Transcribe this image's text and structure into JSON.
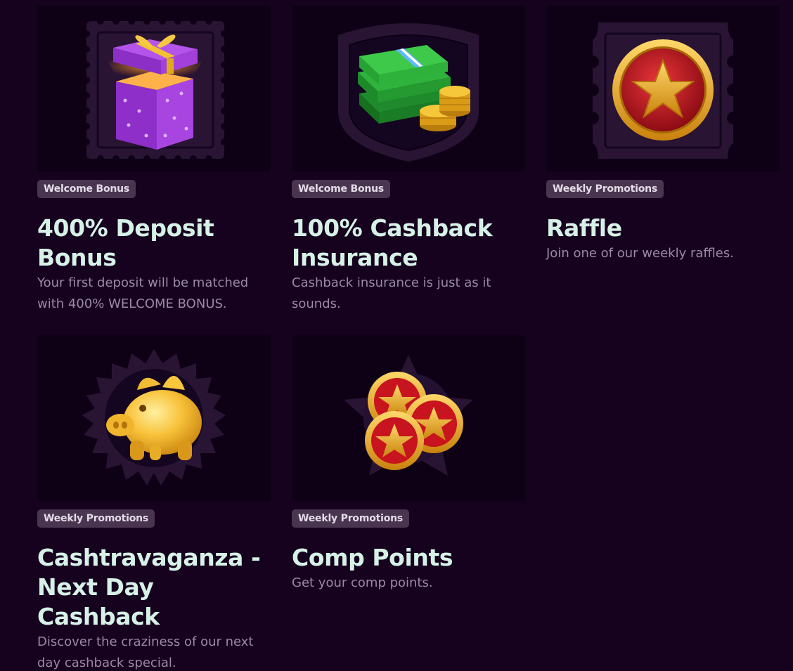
{
  "promotions": [
    {
      "badge": "Welcome Bonus",
      "title": "400% Deposit Bonus",
      "description": "Your first deposit will be matched with 400% WELCOME BONUS.",
      "icon": "gift-box-icon"
    },
    {
      "badge": "Welcome Bonus",
      "title": "100% Cashback Insurance",
      "description": "Cashback insurance is just as it sounds.",
      "icon": "cash-and-coins-icon"
    },
    {
      "badge": "Weekly Promotions",
      "title": "Raffle",
      "description": "Join one of our weekly raffles.",
      "icon": "star-medal-icon"
    },
    {
      "badge": "Weekly Promotions",
      "title": "Cashtravaganza - Next Day Cashback",
      "description": "Discover the craziness of our next day cashback special.",
      "icon": "piggy-bank-icon"
    },
    {
      "badge": "Weekly Promotions",
      "title": "Comp Points",
      "description": "Get your comp points.",
      "icon": "star-coins-icon"
    }
  ],
  "colors": {
    "background": "#16011f",
    "card_image_bg": "#0e0116",
    "badge_bg": "#4a3550",
    "title": "#d6f1e6",
    "description": "#9b8aa5"
  }
}
